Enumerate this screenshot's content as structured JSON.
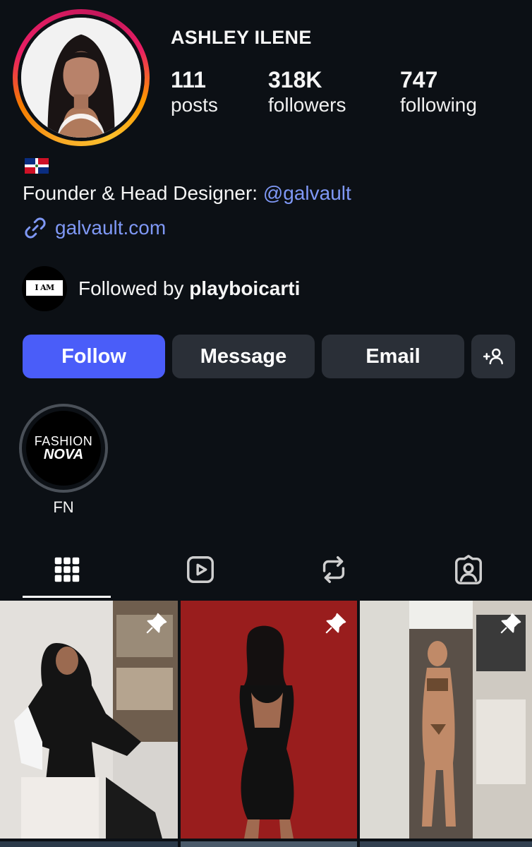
{
  "profile": {
    "name": "ASHLEY ILENE",
    "stats": {
      "posts_count": "111",
      "posts_label": "posts",
      "followers_count": "318K",
      "followers_label": "followers",
      "following_count": "747",
      "following_label": "following"
    },
    "flag": "dominican-republic-flag",
    "bio_prefix": "Founder & Head Designer: ",
    "bio_mention": "@galvault",
    "link": "galvault.com",
    "followed_by_prefix": "Followed by ",
    "followed_by_user": "playboicarti",
    "followed_by_avatar_text": "I AM MUSIC"
  },
  "actions": {
    "follow": "Follow",
    "message": "Message",
    "email": "Email",
    "add_person_icon": "add-person-icon"
  },
  "highlights": [
    {
      "label": "FN",
      "cover_line1": "FASHION",
      "cover_line2": "NOVA"
    }
  ],
  "tabs": [
    "grid-icon",
    "reels-icon",
    "reposts-icon",
    "tagged-icon"
  ],
  "posts": [
    {
      "pinned": true
    },
    {
      "pinned": true
    },
    {
      "pinned": true
    }
  ],
  "colors": {
    "background": "#0c1015",
    "accent": "#4a5df9",
    "link": "#7f98f5",
    "secondary_button": "#2a2f37"
  }
}
